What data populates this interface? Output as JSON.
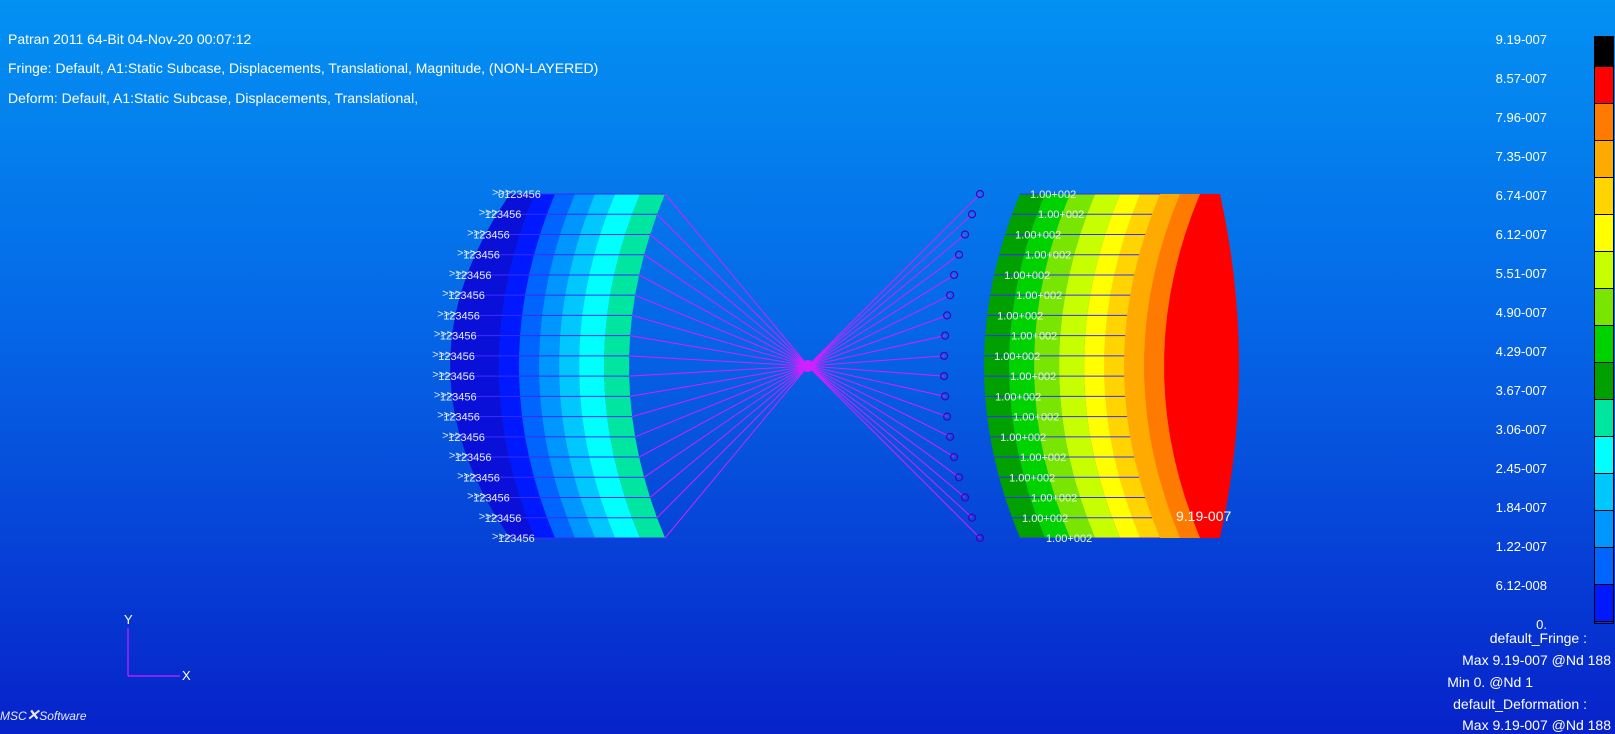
{
  "header": {
    "title_line": "Patran 2011 64-Bit 04-Nov-20 00:07:12",
    "fringe_line": "Fringe: Default, A1:Static Subcase, Displacements, Translational, Magnitude, (NON-LAYERED)",
    "deform_line": "Deform: Default, A1:Static Subcase, Displacements, Translational,"
  },
  "legend": {
    "labels": [
      "9.19-007",
      "8.57-007",
      "7.96-007",
      "7.35-007",
      "6.74-007",
      "6.12-007",
      "5.51-007",
      "4.90-007",
      "4.29-007",
      "3.67-007",
      "3.06-007",
      "2.45-007",
      "1.84-007",
      "1.22-007",
      "6.12-008",
      "0."
    ],
    "colors": [
      "#000000",
      "#ff0000",
      "#ff7a00",
      "#ffaa00",
      "#ffd400",
      "#ffff00",
      "#c8ff00",
      "#78e600",
      "#00d200",
      "#00a000",
      "#00e6a0",
      "#00ffff",
      "#00c8ff",
      "#0096ff",
      "#0064ff",
      "#0019ff"
    ]
  },
  "stats": {
    "fringe_name": "default_Fringe :",
    "fringe_max": "Max 9.19-007 @Nd 188",
    "fringe_min": "Min  0. @Nd 1",
    "deform_name": "default_Deformation :",
    "deform_max": "Max 9.19-007 @Nd 188"
  },
  "model": {
    "left_labels": [
      "0123456",
      "123456",
      "123456",
      "123456",
      "123456",
      "123456",
      "123456",
      "123456",
      "123456",
      "123456",
      "123456",
      "123456",
      "123456",
      "123456",
      "123456",
      "123456",
      "123456",
      "123456"
    ],
    "right_labels": [
      "1.00+002",
      "1.00+002",
      "1.00+002",
      "1.00+002",
      "1.00+002",
      "1.00+002",
      "1.00+002",
      "1.00+002",
      "1.00+002",
      "1.00+002",
      "1.00+002",
      "1.00+002",
      "1.00+002",
      "1.00+002",
      "1.00+002",
      "1.00+002",
      "1.00+002",
      "1.00+002"
    ],
    "max_label": "9.19-007",
    "left_bands": [
      "#0019ff",
      "#0064ff",
      "#0096ff",
      "#00c8ff",
      "#00ffff",
      "#00e6a0"
    ],
    "right_bands": [
      "#00a000",
      "#00d200",
      "#78e600",
      "#c8ff00",
      "#ffff00",
      "#ffd400",
      "#ffaa00",
      "#ff7a00",
      "#ff0000"
    ],
    "mesh_color": "#3a2bff",
    "rbe_color": "#d020ff",
    "node_color": "#4000c0"
  },
  "triad": {
    "y_label": "Y",
    "x_label": "X"
  },
  "logo": {
    "left": "MSC",
    "right": "Software"
  }
}
